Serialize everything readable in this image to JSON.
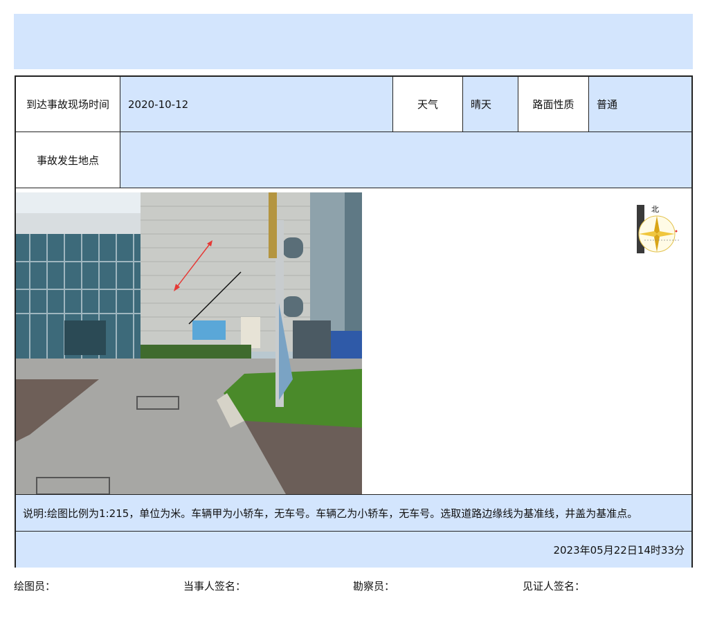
{
  "header": {
    "arrival_label": "到达事故现场时间",
    "arrival_value": "2020-10-12",
    "weather_label": "天气",
    "weather_value": "晴天",
    "road_label": "路面性质",
    "road_value": "普通",
    "location_label": "事故发生地点",
    "location_value": ""
  },
  "compass": {
    "north_label": "北"
  },
  "note": "说明:绘图比例为1:215，单位为米。车辆甲为小轿车，无车号。车辆乙为小轿车，无车号。选取道路边缘线为基准线，井盖为基准点。",
  "datetime": "2023年05月22日14时33分",
  "signatures": {
    "drafter": "绘图员：",
    "party": "当事人签名：",
    "surveyor": "勘察员：",
    "witness": "见证人签名："
  },
  "colors": {
    "accent_fill": "#d3e5fd",
    "border": "#222222",
    "arrow_red": "#e53935"
  }
}
